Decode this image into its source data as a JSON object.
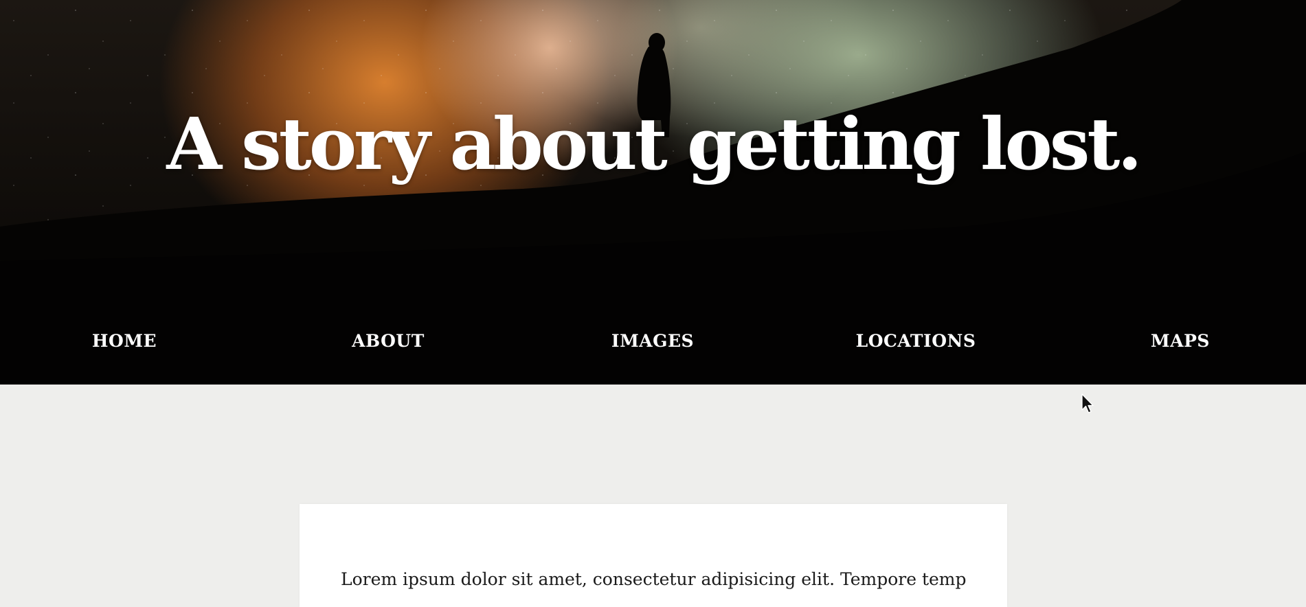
{
  "hero": {
    "title": "A story about getting lost."
  },
  "nav": {
    "items": [
      {
        "id": "home",
        "label": "HOME"
      },
      {
        "id": "about",
        "label": "ABOUT"
      },
      {
        "id": "images",
        "label": "IMAGES"
      },
      {
        "id": "locations",
        "label": "LOCATIONS"
      },
      {
        "id": "maps",
        "label": "MAPS"
      }
    ]
  },
  "article": {
    "text": "Lorem ipsum dolor sit amet, consectetur adipisicing elit. Tempore tempora"
  },
  "icons": {
    "pointer": "mouse-pointer-icon"
  },
  "colors": {
    "hero_background": "#000000",
    "page_background": "#eeeeec",
    "card_background": "#ffffff",
    "nav_text": "#ffffff",
    "body_text": "#1a1a1a"
  }
}
